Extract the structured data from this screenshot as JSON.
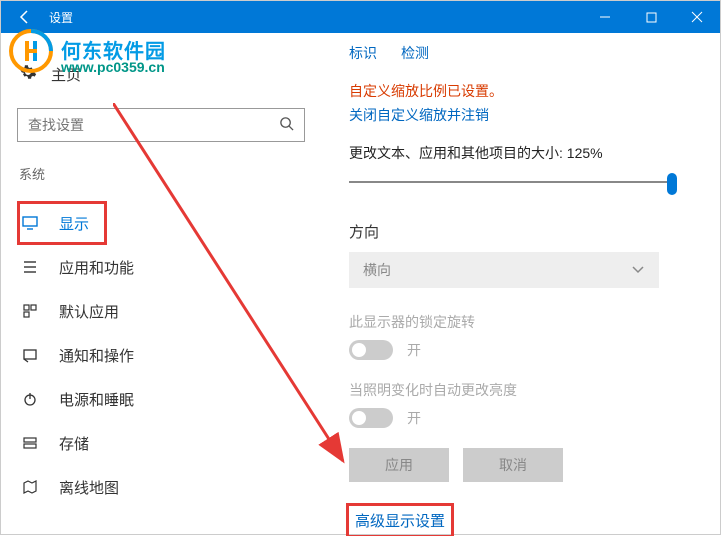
{
  "titlebar": {
    "title": "设置"
  },
  "watermark": {
    "text": "何东软件园",
    "url": "www.pc0359.cn"
  },
  "sidebar": {
    "home": "主页",
    "search_placeholder": "查找设置",
    "group": "系统",
    "items": [
      {
        "icon": "monitor",
        "label": "显示",
        "active": true
      },
      {
        "icon": "list",
        "label": "应用和功能"
      },
      {
        "icon": "defaults",
        "label": "默认应用"
      },
      {
        "icon": "notify",
        "label": "通知和操作"
      },
      {
        "icon": "power",
        "label": "电源和睡眠"
      },
      {
        "icon": "storage",
        "label": "存储"
      },
      {
        "icon": "map",
        "label": "离线地图"
      }
    ]
  },
  "main": {
    "top_link_identify": "标识",
    "top_link_detect": "检测",
    "warn_text": "自定义缩放比例已设置。",
    "logout_link": "关闭自定义缩放并注销",
    "size_label": "更改文本、应用和其他项目的大小: 125%",
    "direction_label": "方向",
    "direction_value": "横向",
    "lock_label": "此显示器的锁定旋转",
    "toggle_on": "开",
    "brightness_label": "当照明变化时自动更改亮度",
    "apply": "应用",
    "cancel": "取消",
    "advanced": "高级显示设置"
  }
}
